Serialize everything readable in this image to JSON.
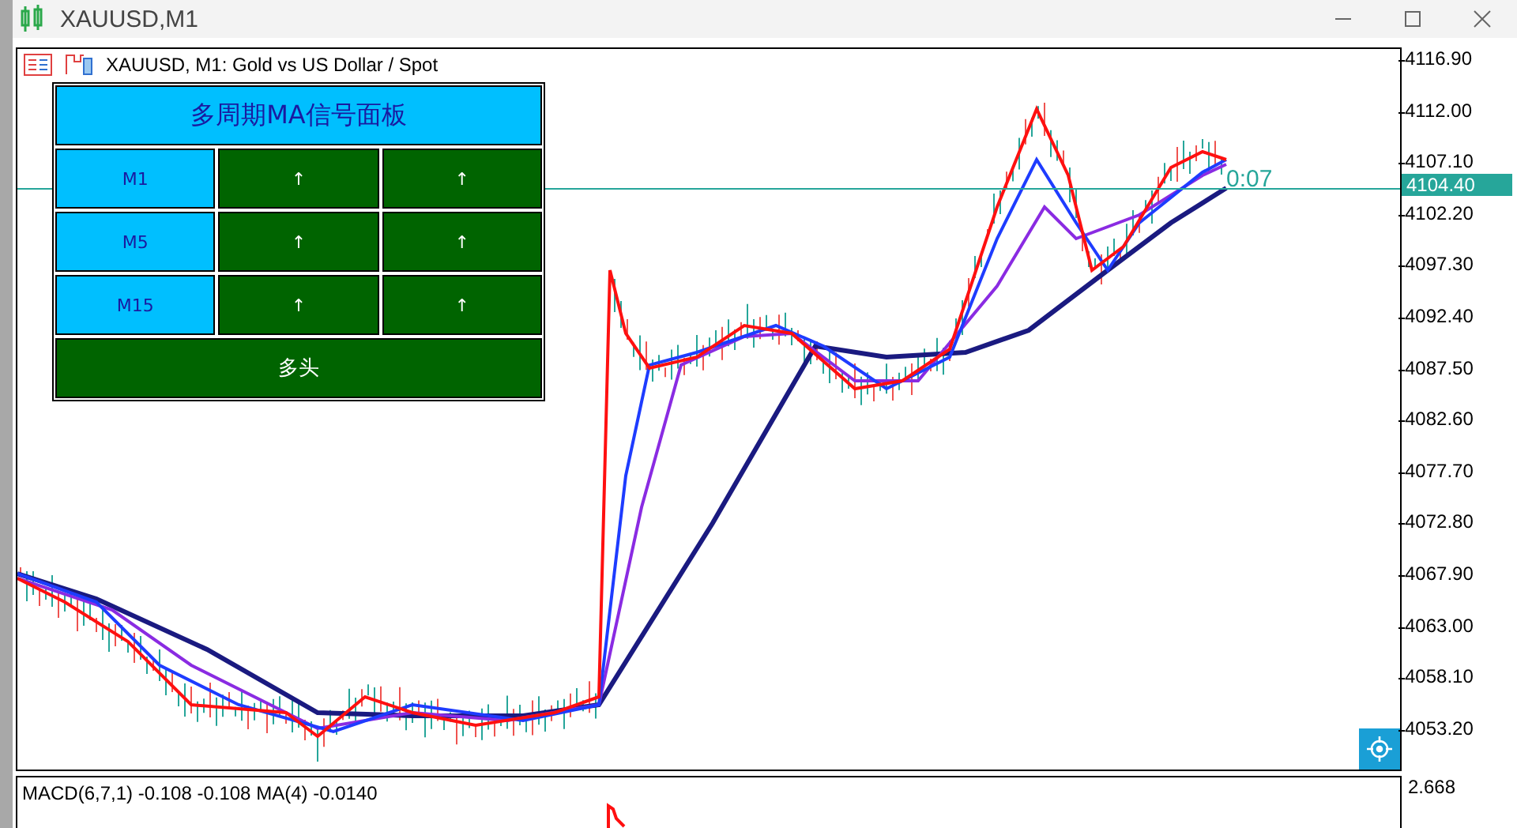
{
  "window": {
    "title": "XAUUSD,M1"
  },
  "chart": {
    "header": "XAUUSD, M1:  Gold vs US Dollar / Spot",
    "price_axis": [
      "4116.90",
      "4112.00",
      "4107.10",
      "4102.20",
      "4097.30",
      "4092.40",
      "4087.50",
      "4082.60",
      "4077.70",
      "4072.80",
      "4067.90",
      "4063.00",
      "4058.10",
      "4053.20"
    ],
    "current_price": "4104.40",
    "bar_countdown": "0:07"
  },
  "signal_panel": {
    "title": "多周期MA信号面板",
    "rows": [
      {
        "timeframe": "M1",
        "signals": [
          "↑",
          "↑"
        ]
      },
      {
        "timeframe": "M5",
        "signals": [
          "↑",
          "↑"
        ]
      },
      {
        "timeframe": "M15",
        "signals": [
          "↑",
          "↑"
        ]
      }
    ],
    "verdict": "多头"
  },
  "macd": {
    "label": "MACD(6,7,1) -0.108 -0.108 MA(4) -0.0140",
    "axis_value": "2.668"
  }
}
